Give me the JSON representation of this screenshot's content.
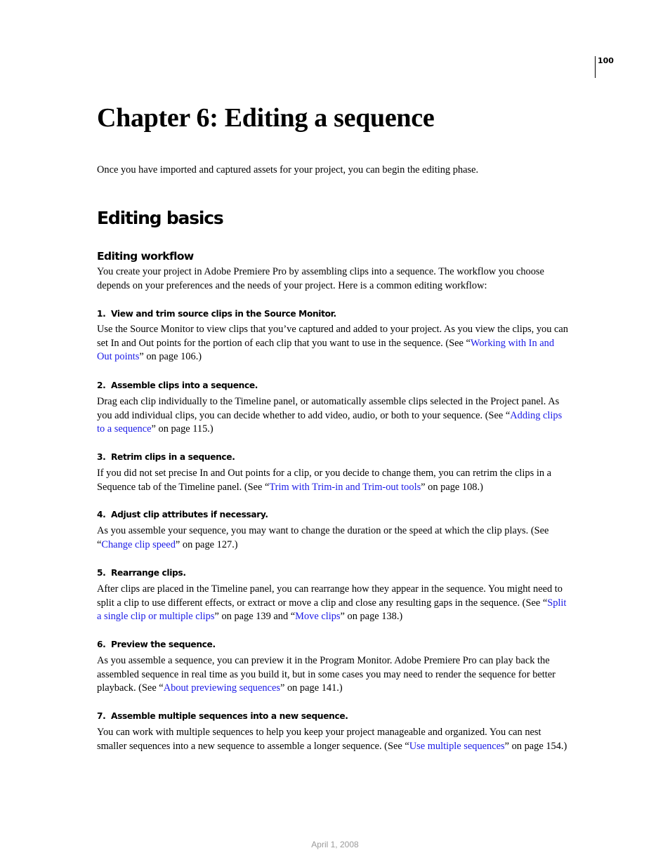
{
  "page_number": "100",
  "chapter_title": "Chapter 6: Editing a sequence",
  "intro": "Once you have imported and captured assets for your project, you can begin the editing phase.",
  "section_title": "Editing basics",
  "subsection_title": "Editing workflow",
  "subsection_intro": {
    "line1": "You create your project in Adobe Premiere Pro by assembling clips into a sequence. The workflow you choose",
    "line2": "depends on your preferences and the needs of your project. Here is a common editing workflow:"
  },
  "steps": [
    {
      "number": "1.",
      "title": "View and trim source clips in the Source Monitor.",
      "l1": "Use the Source Monitor to view clips that you’ve captured and added to your project. As you view the clips, you can",
      "l2_pre": "set In and Out points for the portion of each clip that you want to use in the sequence. (See “",
      "link_a": "Working with In and",
      "link_b": "Out points",
      "l3_post": "” on page 106.)"
    },
    {
      "number": "2.",
      "title": "Assemble clips into a sequence.",
      "l1": "Drag each clip individually to the Timeline panel, or automatically assemble clips selected in the Project panel. As",
      "l2_pre": "you add individual clips, you can decide whether to add video, audio, or both to your sequence. (See “",
      "link_a": "Adding clips",
      "link_b": "to a sequence",
      "l3_post": "” on page 115.)"
    },
    {
      "number": "3.",
      "title": "Retrim clips in a sequence.",
      "l1": "If you did not set precise In and Out points for a clip, or you decide to change them, you can retrim the clips in a",
      "l2_pre": "Sequence tab of the Timeline panel. (See “",
      "link": "Trim with Trim-in and Trim-out tools",
      "l2_post": "” on page 108.)"
    },
    {
      "number": "4.",
      "title": "Adjust clip attributes if necessary.",
      "l1": "As you assemble your sequence, you may want to change the duration or the speed at which the clip plays. (See",
      "l2_pre": "“",
      "link": "Change clip speed",
      "l2_post": "” on page 127.)"
    },
    {
      "number": "5.",
      "title": "Rearrange clips.",
      "l1": "After clips are placed in the Timeline panel, you can rearrange how they appear in the sequence. You might need to",
      "l2_pre": "split a clip to use different effects, or extract or move a clip and close any resulting gaps in the sequence. (See “",
      "link1_a": "Split",
      "link1_b": "a single clip or multiple clips",
      "l3_mid": "” on page 139 and “",
      "link2": "Move clips",
      "l3_post": "” on page 138.)"
    },
    {
      "number": "6.",
      "title": "Preview the sequence.",
      "l1": "As you assemble a sequence, you can preview it in the Program Monitor. Adobe Premiere Pro can play back the",
      "l2": "assembled sequence in real time as you build it, but in some cases you may need to render the sequence for better",
      "l3_pre": "playback. (See “",
      "link": "About previewing sequences",
      "l3_post": "” on page 141.)"
    },
    {
      "number": "7.",
      "title": "Assemble multiple sequences into a new sequence.",
      "l1": "You can work with multiple sequences to help you keep your project manageable and organized. You can nest",
      "l2_pre": "smaller sequences into a new sequence to assemble a longer sequence. (See “",
      "link": "Use multiple sequences",
      "l2_post": "” on page 154.)"
    }
  ],
  "footer_date": "April 1, 2008",
  "colors": {
    "link": "#1a1ae6",
    "footer": "#9a9a9a",
    "text": "#000000"
  }
}
